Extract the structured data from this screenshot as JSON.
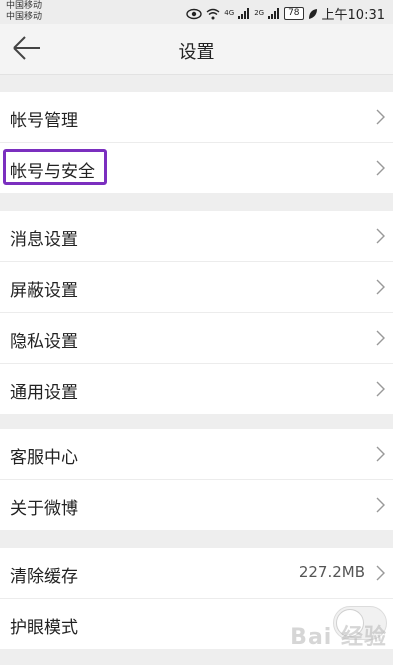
{
  "status": {
    "carrier1": "中国移动",
    "carrier2": "中国移动",
    "net1": "4G",
    "net2": "2G",
    "battery": "78",
    "time": "上午10:31"
  },
  "header": {
    "title": "设置"
  },
  "groups": [
    {
      "items": [
        {
          "label": "帐号管理"
        },
        {
          "label": "帐号与安全"
        }
      ]
    },
    {
      "items": [
        {
          "label": "消息设置"
        },
        {
          "label": "屏蔽设置"
        },
        {
          "label": "隐私设置"
        },
        {
          "label": "通用设置"
        }
      ]
    },
    {
      "items": [
        {
          "label": "客服中心"
        },
        {
          "label": "关于微博"
        }
      ]
    },
    {
      "items": [
        {
          "label": "清除缓存",
          "value": "227.2MB"
        },
        {
          "label": "护眼模式",
          "toggle": false
        }
      ]
    }
  ],
  "watermark": "Bai 经验",
  "colors": {
    "highlight": "#7b2fbf",
    "background": "#eeeeee"
  }
}
